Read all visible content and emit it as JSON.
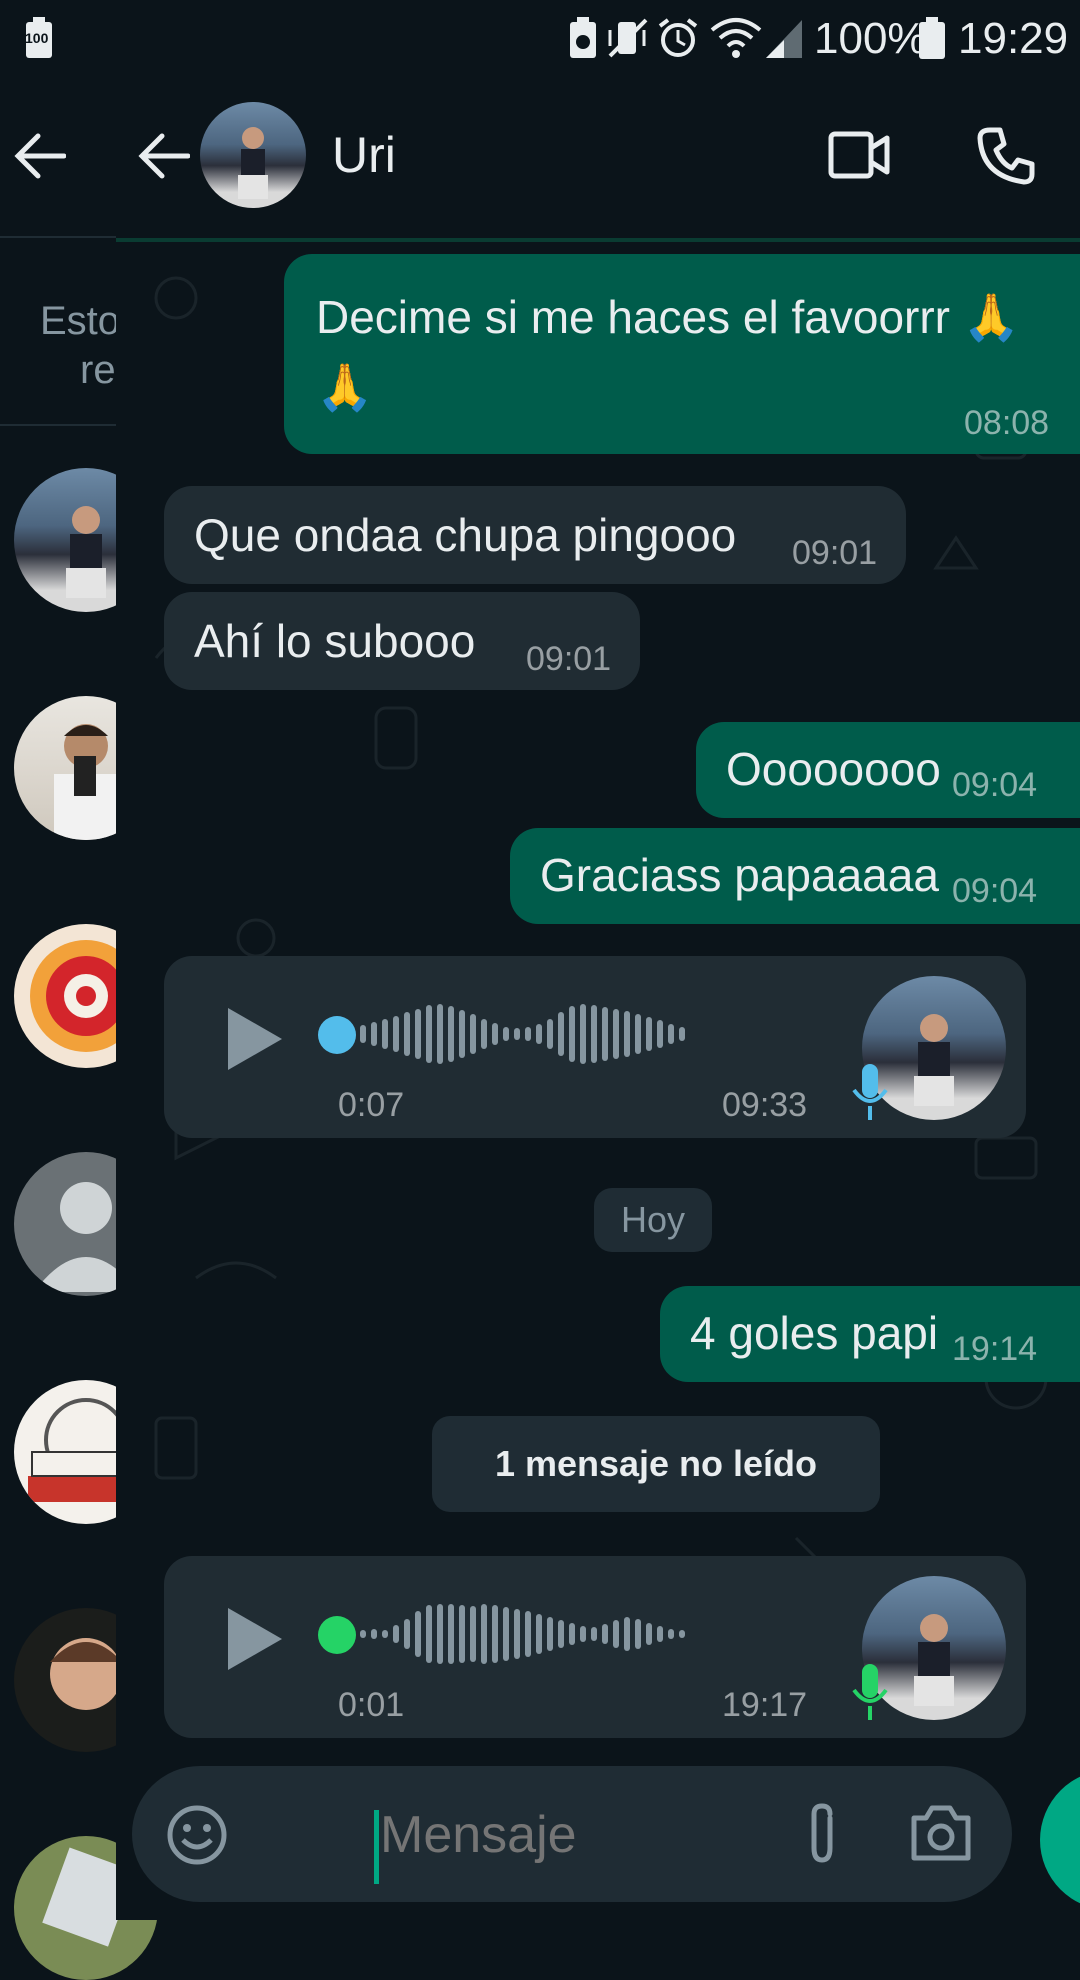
{
  "status_bar": {
    "battery_left": "100",
    "battery_pct": "100%",
    "time": "19:29"
  },
  "left_pane": {
    "tab_text_line1": "Esto",
    "tab_text_line2": "re"
  },
  "header": {
    "contact_name": "Uri"
  },
  "messages": [
    {
      "dir": "out",
      "text": "Decime si me haces el favoorrr 🙏🙏",
      "time": "08:08"
    },
    {
      "dir": "in",
      "text": "Que ondaa chupa pingooo",
      "time": "09:01"
    },
    {
      "dir": "in",
      "text": "Ahí lo subooo",
      "time": "09:01"
    },
    {
      "dir": "out",
      "text": "Oooooooo",
      "time": "09:04"
    },
    {
      "dir": "out",
      "text": "Graciass papaaaaa",
      "time": "09:04"
    },
    {
      "dir": "in",
      "type": "voice",
      "duration": "0:07",
      "time": "09:33",
      "progress": 0
    },
    {
      "dir": "out",
      "text": "4 goles papi",
      "time": "19:14"
    },
    {
      "dir": "in",
      "type": "voice",
      "duration": "0:01",
      "time": "19:17",
      "progress": 0
    }
  ],
  "date_separator": "Hoy",
  "unread_banner": "1 mensaje no leído",
  "input": {
    "placeholder": "Mensaje"
  },
  "colors": {
    "background": "#0b141a",
    "outgoing_bubble": "#005c4b",
    "incoming_bubble": "#202c33",
    "accent_green": "#00a884",
    "played_dot": "#53bdeb",
    "new_dot": "#25d366"
  },
  "icons": [
    "back-arrow-icon",
    "video-call-icon",
    "phone-icon",
    "emoji-icon",
    "attach-icon",
    "camera-icon",
    "play-icon",
    "mic-icon"
  ]
}
